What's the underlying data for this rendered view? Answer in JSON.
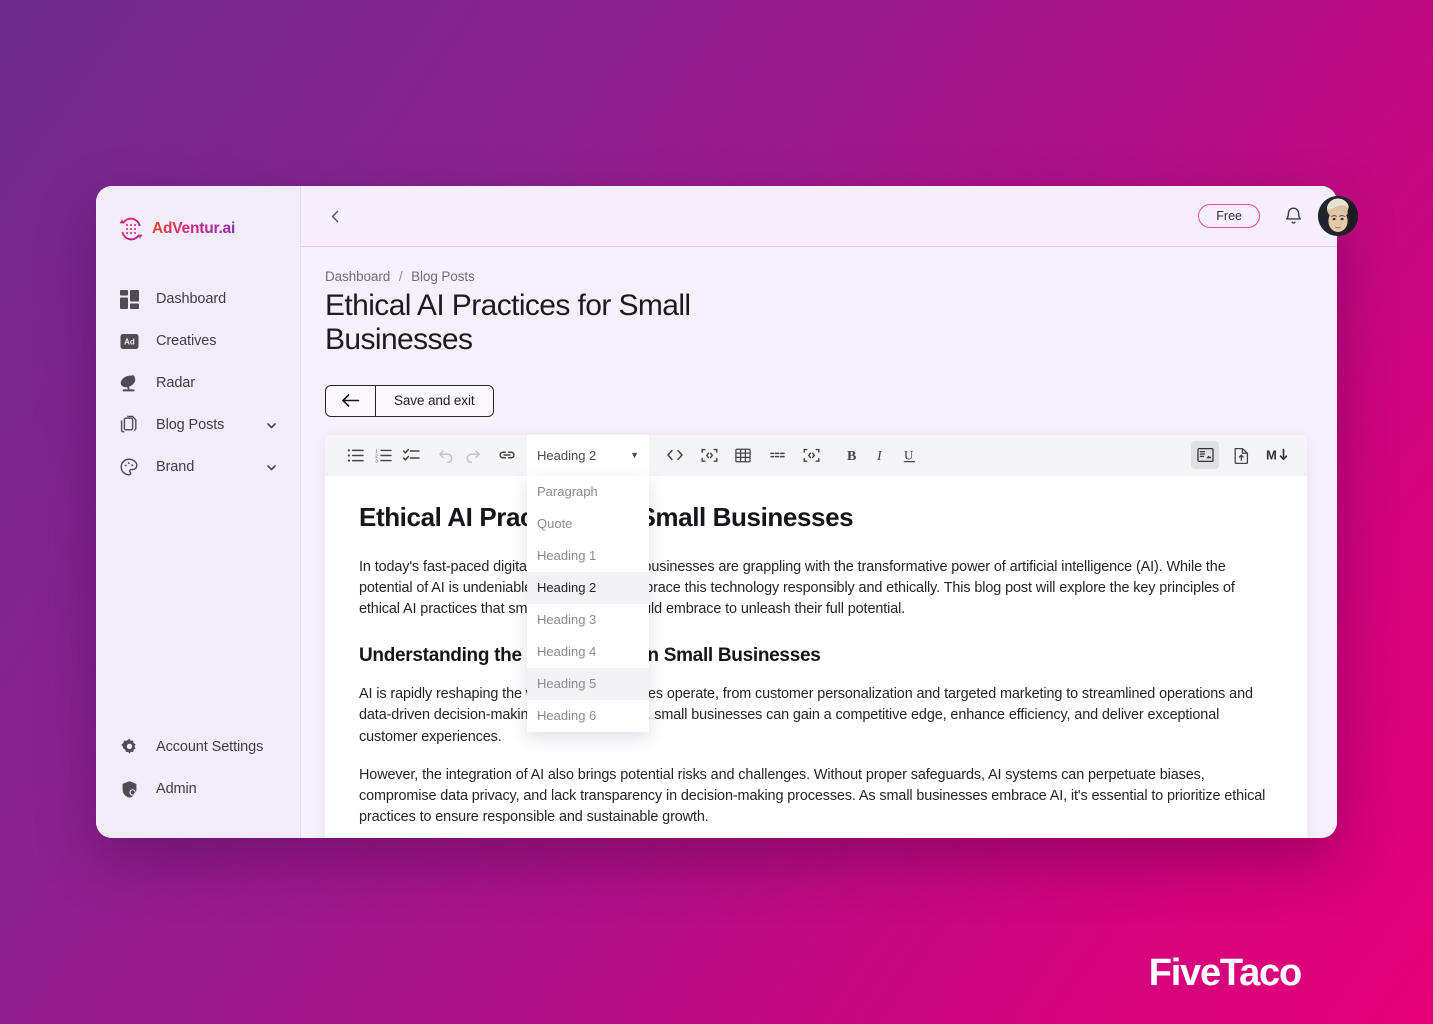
{
  "brand": {
    "logo_text": "AdVentur.ai",
    "logo_icon": "refresh-grid-logo-icon",
    "watermark": "FiveTaco",
    "accent_pink": "#ec4a93",
    "accent_magenta": "#e2007a",
    "bg_gradient_start": "#6e2a8e",
    "bg_gradient_end": "#e60076"
  },
  "sidebar": {
    "items": [
      {
        "label": "Dashboard",
        "icon": "dashboard-grid-icon",
        "expandable": false
      },
      {
        "label": "Creatives",
        "icon": "ad-badge-icon",
        "expandable": false
      },
      {
        "label": "Radar",
        "icon": "satellite-dish-icon",
        "expandable": false
      },
      {
        "label": "Blog Posts",
        "icon": "documents-stack-icon",
        "expandable": true
      },
      {
        "label": "Brand",
        "icon": "palette-icon",
        "expandable": true
      }
    ],
    "bottom_items": [
      {
        "label": "Account Settings",
        "icon": "gear-icon"
      },
      {
        "label": "Admin",
        "icon": "shield-user-icon"
      }
    ]
  },
  "topbar": {
    "back_icon": "chevron-left-icon",
    "plan_badge": "Free",
    "bell_icon": "bell-icon",
    "avatar": "user-avatar"
  },
  "breadcrumb": {
    "items": [
      "Dashboard",
      "Blog Posts"
    ],
    "separator": "/"
  },
  "page": {
    "title": "Ethical AI Practices for Small Businesses"
  },
  "actions": {
    "back_icon": "arrow-left-icon",
    "save_and_exit": "Save and exit"
  },
  "toolbar": {
    "left_buttons": [
      {
        "name": "bullet-list-icon",
        "label": "Bulleted list",
        "disabled": false
      },
      {
        "name": "numbered-list-icon",
        "label": "Numbered list",
        "disabled": false
      },
      {
        "name": "checklist-icon",
        "label": "Check list",
        "disabled": false
      },
      {
        "name": "undo-icon",
        "label": "Undo",
        "disabled": true
      },
      {
        "name": "redo-icon",
        "label": "Redo",
        "disabled": true
      },
      {
        "name": "link-icon",
        "label": "Insert link",
        "disabled": false
      }
    ],
    "mid_buttons": [
      {
        "name": "inline-code-icon",
        "label": "Inline code",
        "disabled": false
      },
      {
        "name": "code-block-icon",
        "label": "Code block",
        "disabled": false
      },
      {
        "name": "table-icon",
        "label": "Insert table",
        "disabled": false
      },
      {
        "name": "horizontal-rule-icon",
        "label": "Horizontal rule",
        "disabled": false
      },
      {
        "name": "embed-block-icon",
        "label": "Embed block",
        "disabled": false
      },
      {
        "name": "bold-icon",
        "label": "B",
        "disabled": false
      },
      {
        "name": "italic-icon",
        "label": "I",
        "disabled": false
      },
      {
        "name": "underline-icon",
        "label": "U",
        "disabled": false
      }
    ],
    "right_buttons": [
      {
        "name": "rich-text-view-icon",
        "label": "Rich text view",
        "active": true
      },
      {
        "name": "document-export-icon",
        "label": "Export document",
        "active": false
      },
      {
        "name": "markdown-icon",
        "label": "Markdown",
        "active": false
      }
    ]
  },
  "block_dropdown": {
    "selected": "Heading 2",
    "caret_icon": "caret-down-icon",
    "open": true,
    "options": [
      {
        "label": "Paragraph",
        "state": "normal"
      },
      {
        "label": "Quote",
        "state": "normal"
      },
      {
        "label": "Heading 1",
        "state": "normal"
      },
      {
        "label": "Heading 2",
        "state": "selected"
      },
      {
        "label": "Heading 3",
        "state": "normal"
      },
      {
        "label": "Heading 4",
        "state": "normal"
      },
      {
        "label": "Heading 5",
        "state": "hover"
      },
      {
        "label": "Heading 6",
        "state": "normal"
      }
    ]
  },
  "document": {
    "h1": "Ethical AI Practices for Small Businesses",
    "p1": "In today's fast-paced digital landscape, small businesses are grappling with the transformative power of artificial intelligence (AI). While the potential of AI is undeniable, it is crucial to embrace this technology responsibly and ethically. This blog post will explore the key principles of ethical AI practices that small businesses should embrace to unleash their full potential.",
    "h2": "Understanding the Impact of AI on Small Businesses",
    "p2": "AI is rapidly reshaping the way small businesses operate, from customer personalization and targeted marketing to streamlined operations and data-driven decision-making. By leveraging AI, small businesses can gain a competitive edge, enhance efficiency, and deliver exceptional customer experiences.",
    "p3": "However, the integration of AI also brings potential risks and challenges. Without proper safeguards, AI systems can perpetuate biases, compromise data privacy, and lack transparency in decision-making processes. As small businesses embrace AI, it's essential to prioritize ethical practices to ensure responsible and sustainable growth."
  }
}
